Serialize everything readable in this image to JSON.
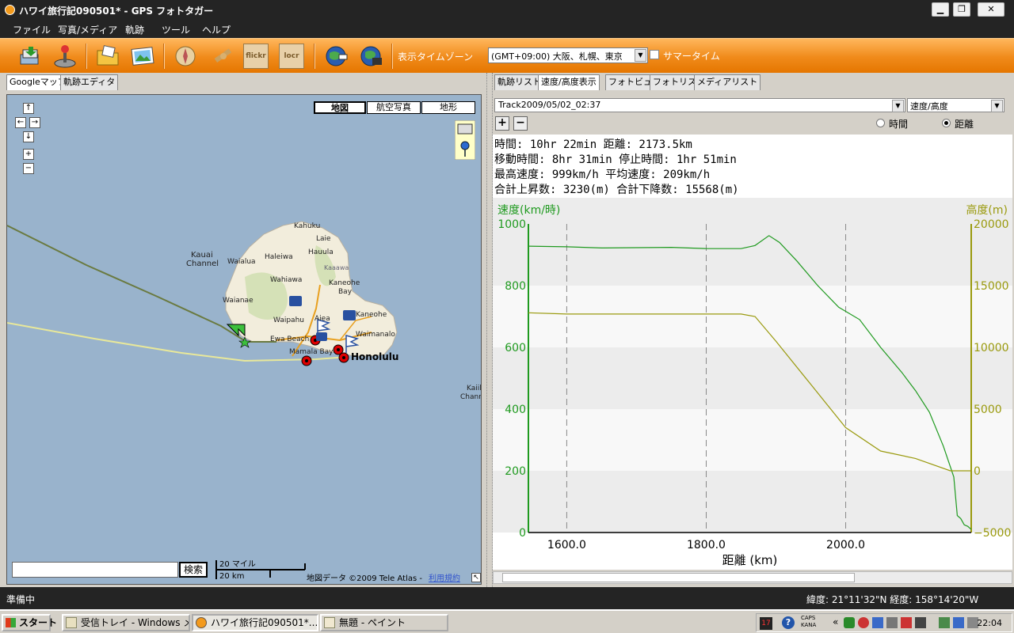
{
  "window": {
    "title": "ハワイ旅行記090501* - GPS フォトタガー",
    "min_label": "▁",
    "max_label": "❐",
    "close_label": "✕"
  },
  "menu": [
    "ファイル",
    "写真/メディア",
    "軌跡",
    "ツール",
    "ヘルプ"
  ],
  "toolbar": {
    "timezone_label": "表示タイムゾーン",
    "timezone_value": "(GMT+09:00) 大阪、札幌、東京",
    "summer_time_label": "サマータイム",
    "icons": [
      "import-icon",
      "joystick-icon",
      "folder-icon",
      "photo-icon",
      "compass-icon",
      "satellite-icon",
      "flickr-icon",
      "locr-icon",
      "earth-icon",
      "movie-icon"
    ],
    "flickr_text": "flickr",
    "locr_text": "locr"
  },
  "left_tabs": [
    "Googleマップ",
    "軌跡エディタ"
  ],
  "map": {
    "types": [
      "地図",
      "航空写真",
      "地形"
    ],
    "pan_up": "↑",
    "pan_left": "←",
    "pan_right": "→",
    "pan_down": "↓",
    "zoom_in": "+",
    "zoom_out": "−",
    "search_button": "検索",
    "scale_miles": "20 マイル",
    "scale_km": "20 km",
    "attribution": "地図データ ©2009 Tele Atlas - ",
    "terms_link": "利用規約",
    "labels": [
      "Kahuku",
      "Laie",
      "Kauai",
      "Channel",
      "Waialua",
      "Haleiwa",
      "Hauula",
      "Kaaawa",
      "Wahiawa",
      "Kaneohe",
      "Bay",
      "Waianae",
      "Waipahu",
      "Aiea",
      "Kaneohe",
      "Ewa Beach",
      "Waimanalo",
      "Mamala Bay",
      "Honolulu",
      "Kaiil",
      "Chann"
    ]
  },
  "right_tabs": [
    "軌跡リスト",
    "速度/高度表示",
    "フォトビュー",
    "フォトリスト",
    "メディアリスト"
  ],
  "track": {
    "selected": "Track2009/05/02_02:37",
    "mode": "速度/高度",
    "zoom_in": "+",
    "zoom_out": "−",
    "radio_time": "時間",
    "radio_distance": "距離"
  },
  "stats": [
    "時間: 10hr 22min 距離: 2173.5km",
    "移動時間: 8hr 31min 停止時間: 1hr 51min",
    "最高速度: 999km/h 平均速度: 209km/h",
    "合計上昇数: 3230(m) 合計下降数: 15568(m)"
  ],
  "chart_data": {
    "type": "line",
    "xlabel": "距離 (km)",
    "y_left_label": "速度(km/時)",
    "y_right_label": "高度(m)",
    "x_ticks": [
      "1600.0",
      "1800.0",
      "2000.0"
    ],
    "xlim": [
      1545,
      2180
    ],
    "y_left_ticks": [
      "0",
      "200",
      "400",
      "600",
      "800",
      "1000"
    ],
    "y_right_ticks": [
      "−5000",
      "0",
      "5000",
      "10000",
      "15000",
      "20000"
    ],
    "ylim_left": [
      0,
      1000
    ],
    "ylim_right": [
      -5000,
      20000
    ],
    "grid": true,
    "speed_color": "#1f9a1f",
    "altitude_color": "#9a9a0e",
    "series": [
      {
        "axis": "left",
        "x": [
          1545,
          1600,
          1650,
          1700,
          1750,
          1800,
          1850,
          1870,
          1890,
          1905,
          1930,
          1960,
          1990,
          2020,
          2050,
          2080,
          2100,
          2120,
          2140,
          2155,
          2160,
          2165,
          2170,
          2175,
          2180
        ],
        "values": [
          928,
          926,
          922,
          923,
          924,
          920,
          920,
          930,
          962,
          940,
          880,
          800,
          730,
          690,
          600,
          520,
          460,
          390,
          280,
          180,
          55,
          45,
          25,
          20,
          10
        ]
      },
      {
        "axis": "right",
        "x": [
          1545,
          1600,
          1700,
          1800,
          1850,
          1870,
          1900,
          1950,
          2000,
          2050,
          2100,
          2150,
          2155,
          2180
        ],
        "values": [
          12800,
          12700,
          12700,
          12700,
          12700,
          12500,
          10500,
          7000,
          3500,
          1600,
          1000,
          0,
          0,
          0
        ]
      }
    ]
  },
  "status": {
    "left": "準備中",
    "right": "緯度: 21°11'32\"N  経度: 158°14'20\"W"
  },
  "taskbar": {
    "start": "スタート",
    "items": [
      "受信トレイ - Windows メ...",
      "ハワイ旅行記090501*...",
      "無題 - ペイント"
    ],
    "caps": "CAPS",
    "kana": "KANA",
    "clock": "22:04"
  }
}
